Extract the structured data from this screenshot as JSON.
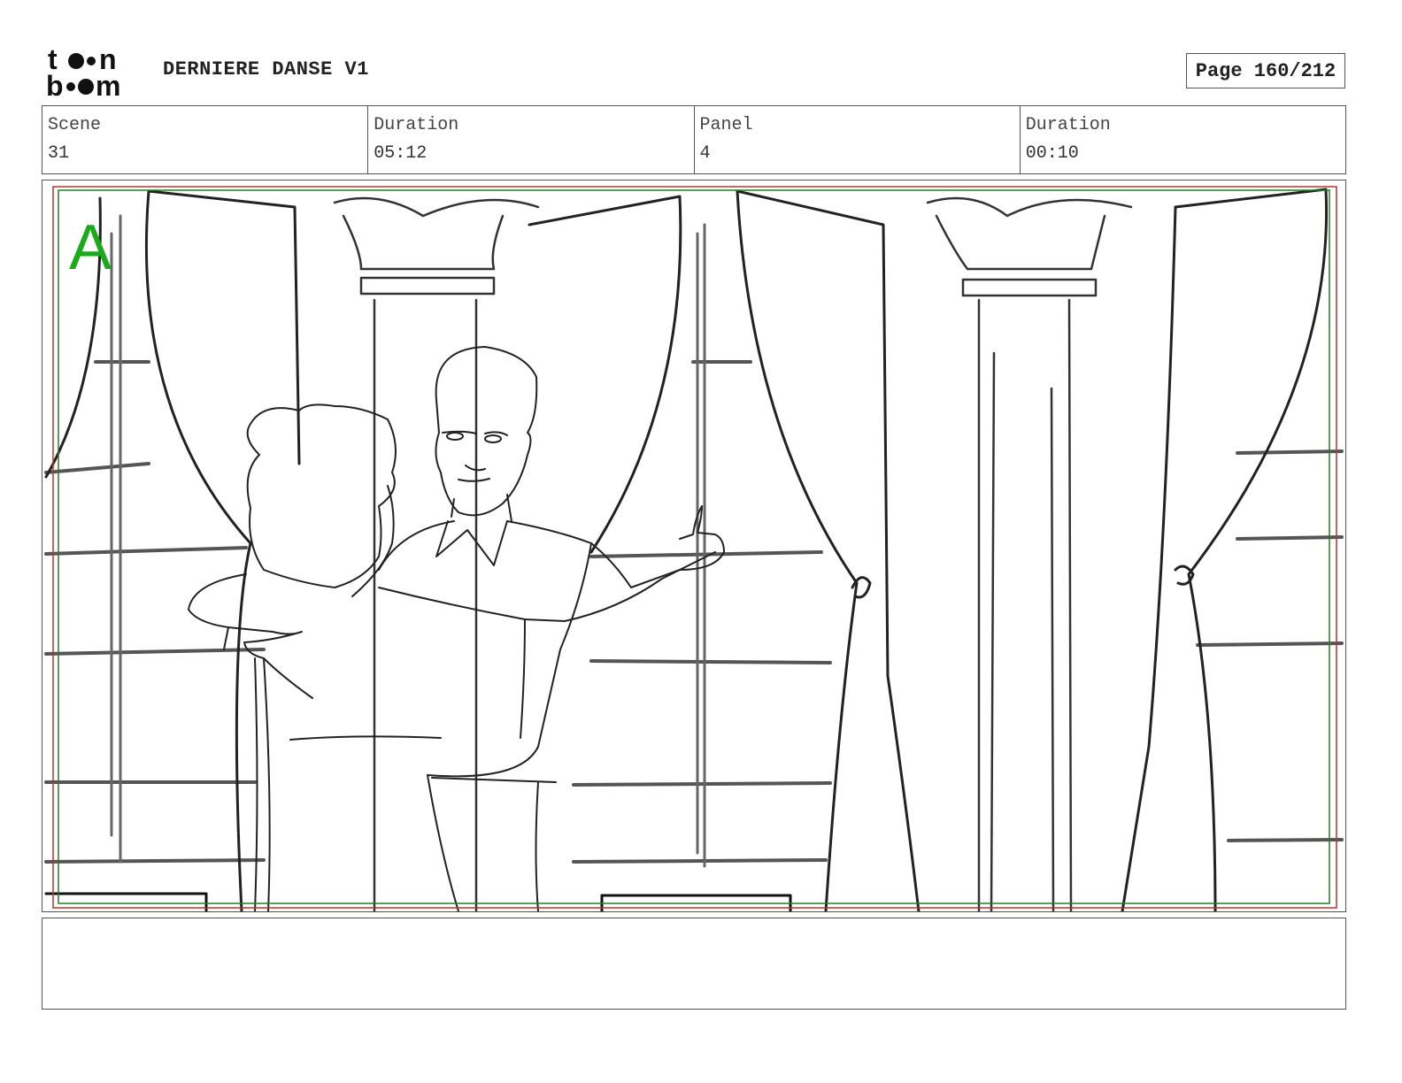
{
  "header": {
    "logo_top": "t●●n",
    "logo_bottom": "b●●m",
    "project_title": "DERNIERE DANSE V1",
    "page_label": "Page 160/212"
  },
  "info": {
    "scene_label": "Scene",
    "scene_value": "31",
    "scene_duration_label": "Duration",
    "scene_duration_value": "05:12",
    "panel_label": "Panel",
    "panel_value": "4",
    "panel_duration_label": "Duration",
    "panel_duration_value": "00:10"
  },
  "panel": {
    "layer_letter": "A",
    "layer_color": "#1aaa1a",
    "safe_frame_color_red": "#c03030",
    "safe_frame_color_green": "#208020"
  },
  "notes": {
    "text": ""
  }
}
